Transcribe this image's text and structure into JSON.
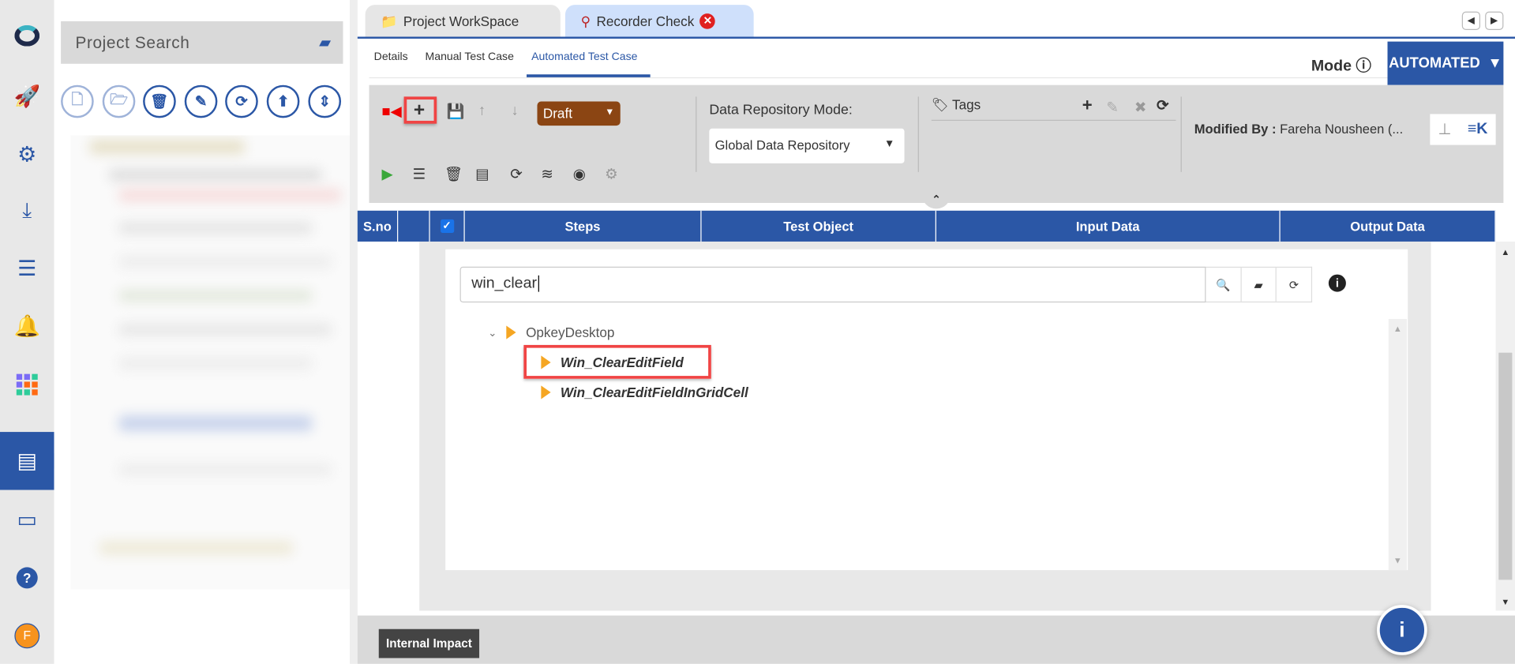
{
  "rail": {
    "items": [
      "rocket-icon",
      "gears-icon",
      "download-icon",
      "list-icon",
      "bell-icon",
      "apps-grid-icon",
      "test-case-icon",
      "docs-icon",
      "help-icon"
    ],
    "avatar": "F"
  },
  "left_panel": {
    "search_placeholder": "Project Search"
  },
  "tabs": [
    {
      "label": "Project WorkSpace"
    },
    {
      "label": "Recorder Check"
    }
  ],
  "subtabs": [
    "Details",
    "Manual Test Case",
    "Automated Test Case"
  ],
  "mode": {
    "label": "Mode",
    "value": "AUTOMATED"
  },
  "toolbar": {
    "status": "Draft",
    "repo_label": "Data Repository Mode:",
    "repo_value": "Global Data Repository",
    "tags_label": "Tags",
    "modified_label": "Modified By :",
    "modified_value": "Fareha Nousheen (..."
  },
  "table": {
    "columns": [
      "S.no",
      "",
      "",
      "Steps",
      "Test Object",
      "Input Data",
      "Output Data"
    ]
  },
  "keyword_search": {
    "value": "win_clear",
    "tree": {
      "root": "OpkeyDesktop",
      "children": [
        "Win_ClearEditField",
        "Win_ClearEditFieldInGridCell"
      ]
    }
  },
  "footer": {
    "internal_impact": "Internal Impact"
  },
  "colors": {
    "primary": "#2b57a6",
    "draft": "#8b4513",
    "highlight": "#f04444",
    "tree_arrow": "#f5a623"
  }
}
